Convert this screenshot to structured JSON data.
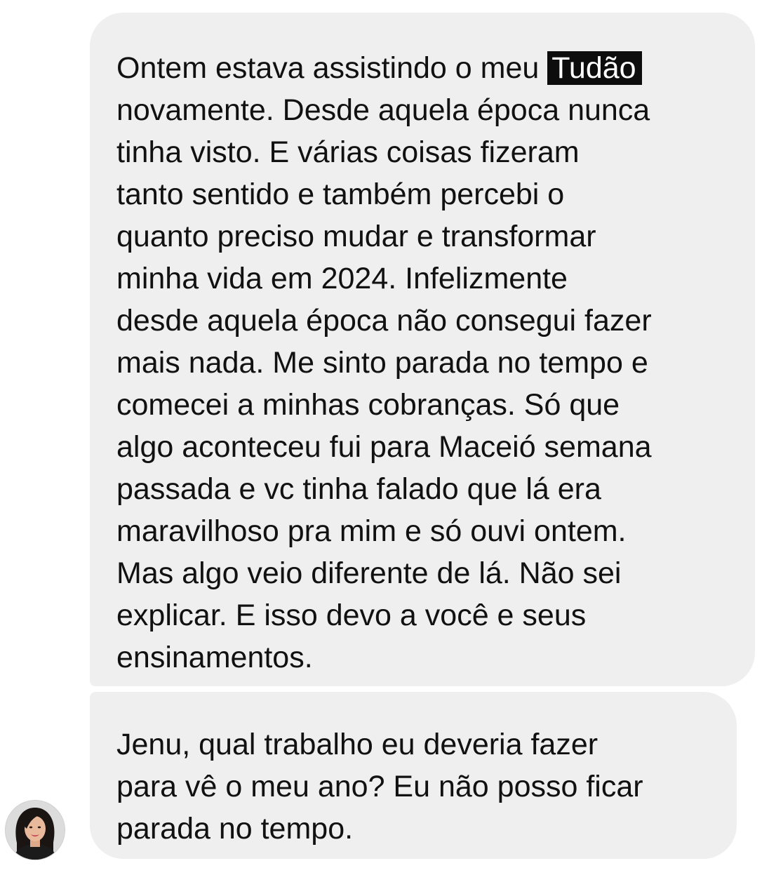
{
  "conversation": {
    "messages": [
      {
        "id": "msg-1",
        "lines": [
          {
            "before": "Ontem estava assistindo o meu ",
            "highlight": "Tudão"
          },
          {
            "text": "novamente. Desde aquela época nunca"
          },
          {
            "text": "tinha visto. E várias coisas fizeram"
          },
          {
            "text": "tanto sentido e também percebi o"
          },
          {
            "text": "quanto preciso mudar e transformar"
          },
          {
            "text": "minha vida em 2024. Infelizmente"
          },
          {
            "text": "desde aquela época não consegui fazer"
          },
          {
            "text": "mais nada. Me sinto parada no tempo e"
          },
          {
            "text": "comecei a minhas cobranças. Só que"
          },
          {
            "text": "algo aconteceu fui para Maceió semana"
          },
          {
            "text": "passada e vc tinha falado que lá era"
          },
          {
            "text": "maravilhoso pra mim e só ouvi ontem."
          },
          {
            "text": "Mas algo veio diferente de lá. Não sei"
          },
          {
            "text": "explicar. E isso devo a você e seus"
          },
          {
            "text": "ensinamentos."
          }
        ]
      },
      {
        "id": "msg-2",
        "lines": [
          {
            "text": "Jenu, qual trabalho eu deveria fazer"
          },
          {
            "text": "para vê o meu ano? Eu não posso ficar"
          },
          {
            "text": "parada no tempo."
          }
        ]
      }
    ],
    "sender_avatar": {
      "icon": "profile-photo",
      "colors": {
        "hair": "#1a1412",
        "skin": "#e8b99b",
        "lips": "#c4324a",
        "shirt": "#1b1b1b",
        "background": "#dcdcdc"
      }
    },
    "colors": {
      "bubble": "#efeff0",
      "text": "#111111",
      "highlight_bg": "#0d0d0d",
      "highlight_text": "#ffffff"
    }
  }
}
